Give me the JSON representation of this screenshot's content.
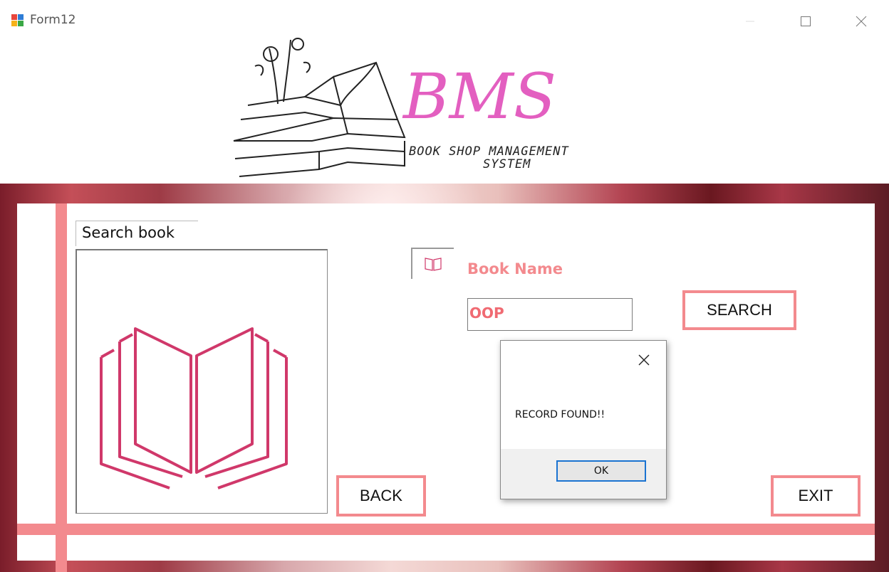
{
  "window": {
    "title": "Form12"
  },
  "logo": {
    "initials": "BMS",
    "tagline_line1": "BOOK SHOP MANAGEMENT",
    "tagline_line2": "SYSTEM"
  },
  "form": {
    "search_label": "Search book",
    "book_name_label": "Book Name",
    "book_name_value": "OOP",
    "search_button": "SEARCH",
    "back_button": "BACK",
    "exit_button": "EXIT"
  },
  "dialog": {
    "message": "RECORD FOUND!!",
    "ok_button": "OK"
  },
  "colors": {
    "accent_pink": "#f38a8e",
    "logo_pink": "#e35fc0",
    "icon_magenta": "#d0386a",
    "focus_blue": "#1a73d1"
  }
}
